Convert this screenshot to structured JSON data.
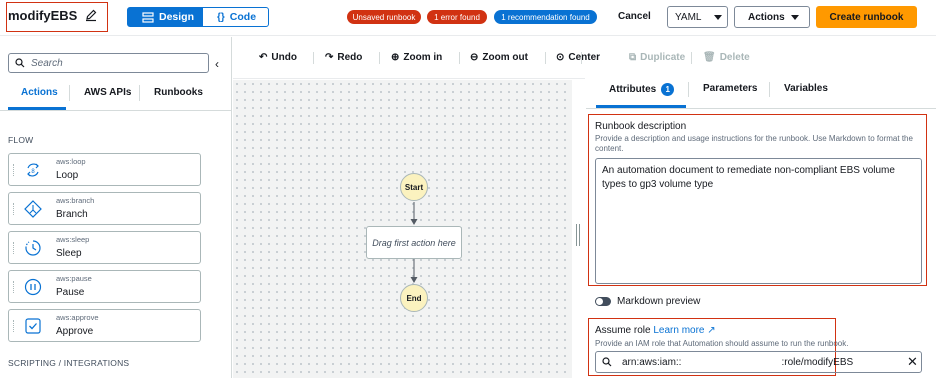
{
  "header": {
    "title": "modifyEBS",
    "design_label": "Design",
    "code_label": "Code",
    "badges": {
      "unsaved": "Unsaved runbook",
      "errors": "1 error found",
      "recommendations": "1 recommendation found"
    },
    "cancel_label": "Cancel",
    "format_select": "YAML",
    "actions_label": "Actions",
    "create_label": "Create runbook"
  },
  "left_panel": {
    "search_placeholder": "Search",
    "tabs": [
      "Actions",
      "AWS APIs",
      "Runbooks"
    ],
    "sections": {
      "flow": "FLOW",
      "scripting": "SCRIPTING / INTEGRATIONS"
    },
    "actions": [
      {
        "type": "aws:loop",
        "name": "Loop",
        "icon": "loop-icon"
      },
      {
        "type": "aws:branch",
        "name": "Branch",
        "icon": "branch-icon"
      },
      {
        "type": "aws:sleep",
        "name": "Sleep",
        "icon": "sleep-icon"
      },
      {
        "type": "aws:pause",
        "name": "Pause",
        "icon": "pause-icon"
      },
      {
        "type": "aws:approve",
        "name": "Approve",
        "icon": "approve-icon"
      }
    ]
  },
  "canvas": {
    "toolbar": {
      "undo": "Undo",
      "redo": "Redo",
      "zoom_in": "Zoom in",
      "zoom_out": "Zoom out",
      "center": "Center",
      "duplicate": "Duplicate",
      "delete": "Delete"
    },
    "start_label": "Start",
    "placeholder_step": "Drag first action here",
    "end_label": "End"
  },
  "right_panel": {
    "tabs": {
      "attributes": "Attributes",
      "attributes_count": "1",
      "parameters": "Parameters",
      "variables": "Variables"
    },
    "description": {
      "label": "Runbook description",
      "help": "Provide a description and usage instructions for the runbook. Use Markdown to format the content.",
      "value": "An automation document to remediate non-compliant EBS volume types to gp3 volume type"
    },
    "markdown_preview_label": "Markdown preview",
    "assume_role": {
      "label": "Assume role",
      "learn_more": "Learn more",
      "help": "Provide an IAM role that Automation should assume to run the runbook.",
      "value_prefix": "arn:aws:iam::",
      "value_suffix": ":role/modifyEBS"
    }
  },
  "colors": {
    "primary": "#0972d3",
    "accent": "#ff9900",
    "error": "#d13212",
    "node_fill": "#fbf2bf"
  }
}
